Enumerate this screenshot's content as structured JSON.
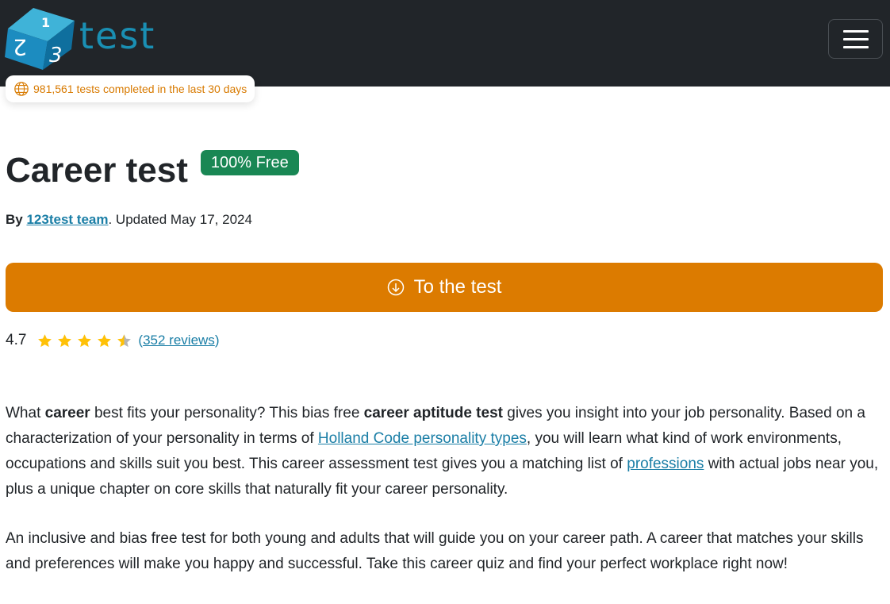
{
  "header": {
    "logo_text": "test",
    "logo_digits": [
      "1",
      "2",
      "3"
    ],
    "menu_icon": "hamburger-icon",
    "stats_text": "981,561 tests completed in the last 30 days",
    "stats_icon": "globe-icon"
  },
  "colors": {
    "navbar_bg": "#212529",
    "accent_orange": "#dc7b00",
    "badge_green": "#198754",
    "link_blue": "#1a7ea6",
    "star_gold": "#ffc107",
    "logo_blue": "#1a8fb3"
  },
  "page": {
    "title": "Career test",
    "badge": "100% Free",
    "byline": {
      "prefix": "By",
      "author": "123test team",
      "suffix": ". Updated May 17, 2024"
    },
    "cta": {
      "label": "To the test",
      "icon": "arrow-down-circle-icon"
    },
    "rating": {
      "value_text": "4.7",
      "value": 4.7,
      "max": 5,
      "paren_open": "(",
      "reviews_link": "352 reviews",
      "paren_close": ")"
    }
  },
  "intro": {
    "p1": {
      "t1": "What ",
      "b1": "career",
      "t2": " best fits your personality? This bias free ",
      "b2": "career aptitude test",
      "t3": " gives you insight into your job personality. Based on a characterization of your personality in terms of ",
      "link1": "Holland Code personality types",
      "t4": ", you will learn what kind of work environments, occupations and skills suit you best. This career assessment test gives you a matching list of ",
      "link2": "professions",
      "t5": " with actual jobs near you, plus a unique chapter on core skills that naturally fit your career personality."
    },
    "p2": "An inclusive and bias free test for both young and adults that will guide you on your career path. A career that matches your skills and preferences will make you happy and successful. Take this career quiz and find your perfect workplace right now!"
  }
}
